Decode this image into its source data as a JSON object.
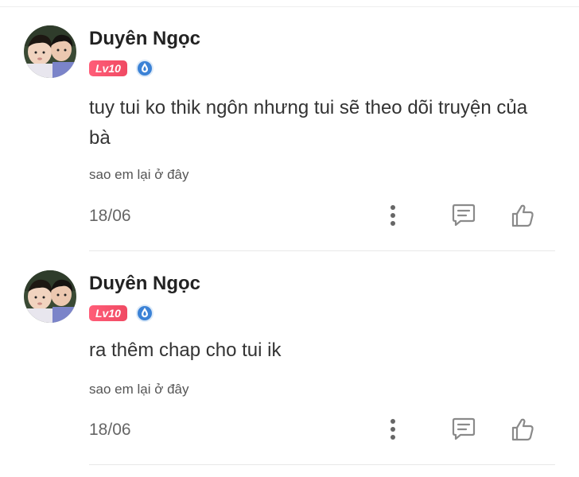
{
  "comments": [
    {
      "username": "Duyên Ngọc",
      "level": "Lv10",
      "text": "tuy tui ko thik ngôn nhưng tui sẽ theo dõi truyện của bà",
      "replied_to": "sao em lại ở đây",
      "date": "18/06"
    },
    {
      "username": "Duyên Ngọc",
      "level": "Lv10",
      "text": "ra thêm chap cho tui ik",
      "replied_to": "sao em lại ở đây",
      "date": "18/06"
    }
  ],
  "icons": {
    "avatar": "avatar-image",
    "rank": "droplet-rank-icon",
    "more": "more-vertical-icon",
    "reply": "comment-icon",
    "like": "thumbs-up-icon"
  },
  "colors": {
    "level_badge": "#f04a63",
    "rank_icon": "#3b82d6",
    "text": "#333333",
    "muted": "#666666",
    "icon": "#888888"
  }
}
